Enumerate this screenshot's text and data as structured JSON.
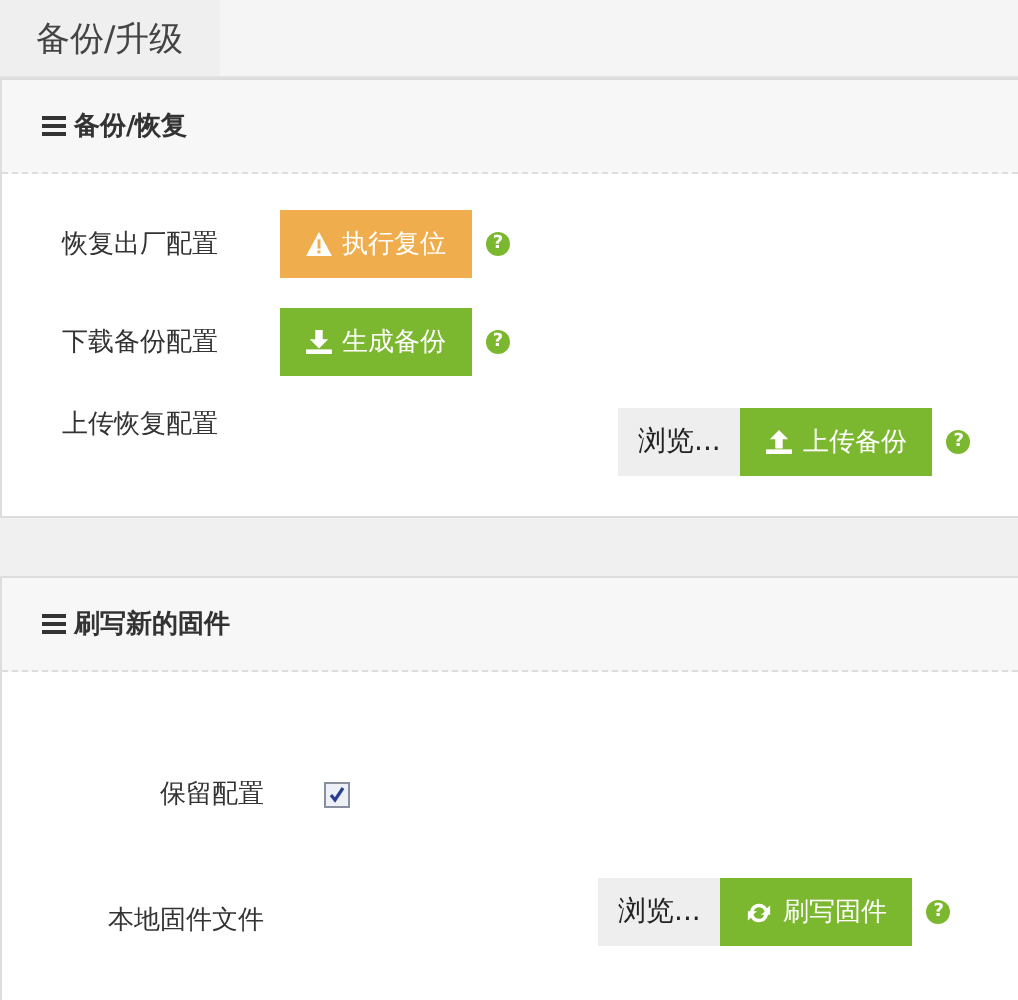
{
  "page_title": "备份/升级",
  "sections": [
    {
      "title": "备份/恢复",
      "kind": "backup",
      "rows": [
        {
          "kind": "action",
          "label": "恢复出厂配置",
          "button": {
            "kind": "warning",
            "text": "执行复位"
          },
          "help": "?"
        },
        {
          "kind": "action",
          "label": "下载备份配置",
          "button": {
            "kind": "download",
            "text": "生成备份"
          },
          "help": "?"
        },
        {
          "kind": "file",
          "label": "上传恢复配置",
          "browse": "浏览...",
          "button": {
            "kind": "upload",
            "text": "上传备份"
          },
          "help": "?"
        }
      ]
    },
    {
      "title": "刷写新的固件",
      "kind": "firmware",
      "rows": [
        {
          "kind": "checkbox",
          "label": "保留配置",
          "checked": true
        },
        {
          "kind": "file",
          "label": "本地固件文件",
          "browse": "浏览...",
          "button": {
            "kind": "refresh",
            "text": "刷写固件"
          },
          "help": "?"
        }
      ]
    }
  ]
}
